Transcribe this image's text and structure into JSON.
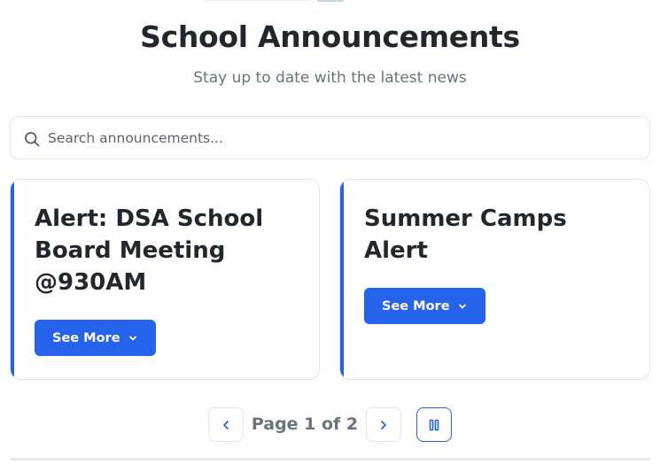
{
  "header": {
    "title": "School Announcements",
    "subtitle": "Stay up to date with the latest news"
  },
  "search": {
    "placeholder": "Search announcements...",
    "icon": "search-icon"
  },
  "announcements": [
    {
      "title": "Alert: DSA School Board Meeting @930AM",
      "button_label": "See More"
    },
    {
      "title": "Summer Camps Alert",
      "button_label": "See More"
    }
  ],
  "pagination": {
    "label": "Page 1 of 2",
    "prev_icon": "chevron-left-icon",
    "next_icon": "chevron-right-icon",
    "pause_icon": "pause-icon"
  },
  "colors": {
    "accent": "#2563eb",
    "title_text": "#23262f",
    "muted_text": "#6b7280",
    "border": "#e3e6ea"
  }
}
